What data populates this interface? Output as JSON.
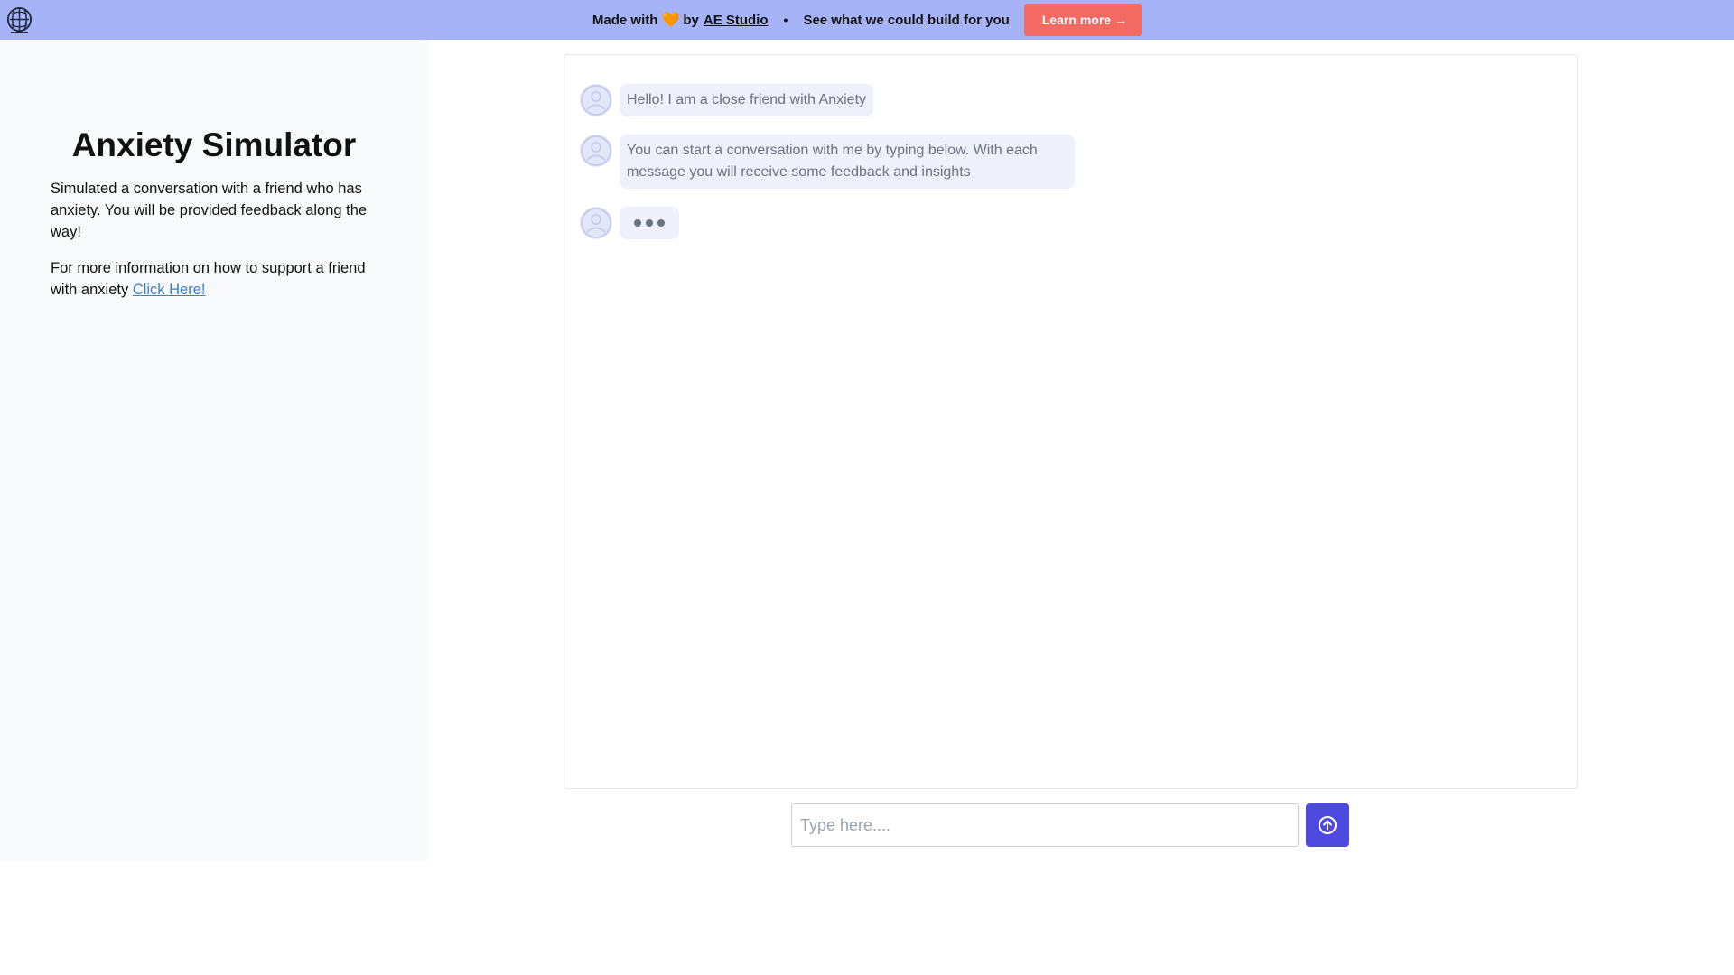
{
  "banner": {
    "made_with": "Made with",
    "heart": "🧡",
    "by": "by",
    "studio": "AE Studio",
    "dot": "•",
    "tagline": "See what we could build for you",
    "learn_more": "Learn more",
    "learn_more_arrow": "→",
    "logo_icon": "brain-globe-icon",
    "heart_color": "#f28a2e",
    "banner_color": "#a6b4f7",
    "button_color": "#f36a63"
  },
  "sidebar": {
    "title": "Anxiety Simulator",
    "description": "Simulated a conversation with a friend who has anxiety. You will be provided feedback along the way!",
    "info_text": "For more information on how to support a friend with anxiety",
    "info_link": "Click Here!"
  },
  "chat": {
    "messages": [
      {
        "text": "Hello! I am a close friend with Anxiety",
        "avatar_icon": "user-avatar-icon"
      },
      {
        "text": "You can start a conversation with me by typing below. With each message you will receive some feedback and insights",
        "avatar_icon": "user-avatar-icon"
      }
    ],
    "typing_indicator": {
      "avatar_icon": "user-avatar-icon",
      "icon": "typing-dots-icon"
    }
  },
  "composer": {
    "placeholder": "Type here....",
    "value": "",
    "send_icon": "arrow-up-circle-icon",
    "send_color": "#4e4ae0"
  }
}
